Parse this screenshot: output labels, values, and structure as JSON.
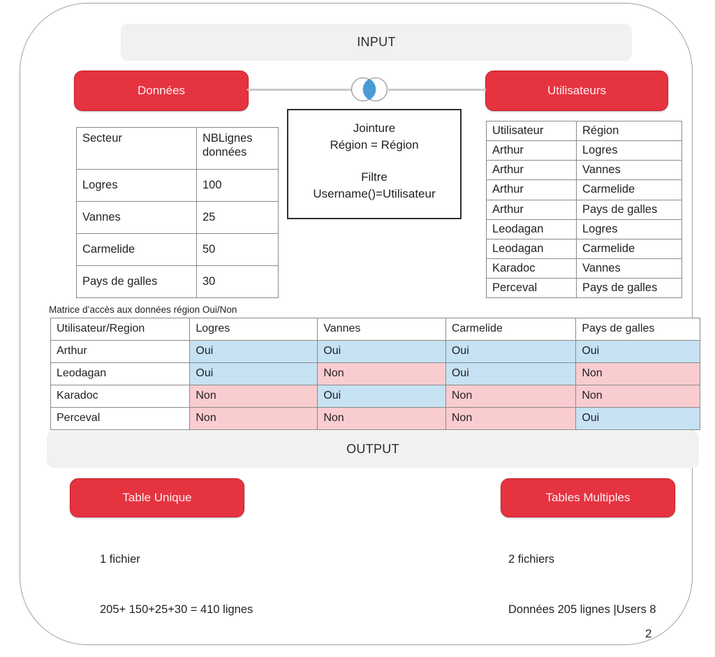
{
  "frame": {
    "page_number": "2"
  },
  "sections": {
    "input_label": "INPUT",
    "output_label": "OUTPUT"
  },
  "buttons": {
    "donnees": "Données",
    "utilisateurs": "Utilisateurs",
    "table_unique": "Table Unique",
    "tables_multiples": "Tables Multiples"
  },
  "icons": {
    "venn": "venn-join-icon"
  },
  "join_box": {
    "line1": "Jointure",
    "line2": "Région = Région",
    "line3": "Filtre",
    "line4": "Username()=Utilisateur"
  },
  "table_secteur": {
    "headers": [
      "Secteur",
      "NBLignes données"
    ],
    "header_col2_line1": "NBLignes",
    "header_col2_line2": "données",
    "rows": [
      [
        "Logres",
        "100"
      ],
      [
        "Vannes",
        "25"
      ],
      [
        "Carmelide",
        "50"
      ],
      [
        "Pays de galles",
        "30"
      ]
    ]
  },
  "table_utilisateurs": {
    "headers": [
      "Utilisateur",
      "Région"
    ],
    "rows": [
      [
        "Arthur",
        "Logres"
      ],
      [
        "Arthur",
        "Vannes"
      ],
      [
        "Arthur",
        "Carmelide"
      ],
      [
        "Arthur",
        "Pays de galles"
      ],
      [
        "Leodagan",
        "Logres"
      ],
      [
        "Leodagan",
        "Carmelide"
      ],
      [
        "Karadoc",
        "Vannes"
      ],
      [
        "Perceval",
        "Pays de galles"
      ]
    ]
  },
  "matrix": {
    "caption": "Matrice d’accès aux données région Oui/Non",
    "headers": [
      "Utilisateur/Region",
      "Logres",
      "Vannes",
      "Carmelide",
      "Pays de galles"
    ],
    "rows": [
      {
        "user": "Arthur",
        "values": [
          "Oui",
          "Oui",
          "Oui",
          "Oui"
        ]
      },
      {
        "user": "Leodagan",
        "values": [
          "Oui",
          "Non",
          "Oui",
          "Non"
        ]
      },
      {
        "user": "Karadoc",
        "values": [
          "Non",
          "Oui",
          "Non",
          "Non"
        ]
      },
      {
        "user": "Perceval",
        "values": [
          "Non",
          "Non",
          "Non",
          "Oui"
        ]
      }
    ],
    "yes_token": "Oui",
    "no_token": "Non"
  },
  "output": {
    "left": {
      "line1": "1 fichier",
      "line2": "205+ 150+25+30 = 410 lignes"
    },
    "right": {
      "line1": "2 fichiers",
      "line2": "Données 205 lignes |Users 8"
    }
  },
  "colors": {
    "brand_red": "#e63340",
    "section_gray": "#f1f1f1",
    "yes_blue": "#c6e2f3",
    "no_pink": "#f9ccd0",
    "venn_blue": "#4a9bd4",
    "frame_gray": "#9e9e9e"
  }
}
